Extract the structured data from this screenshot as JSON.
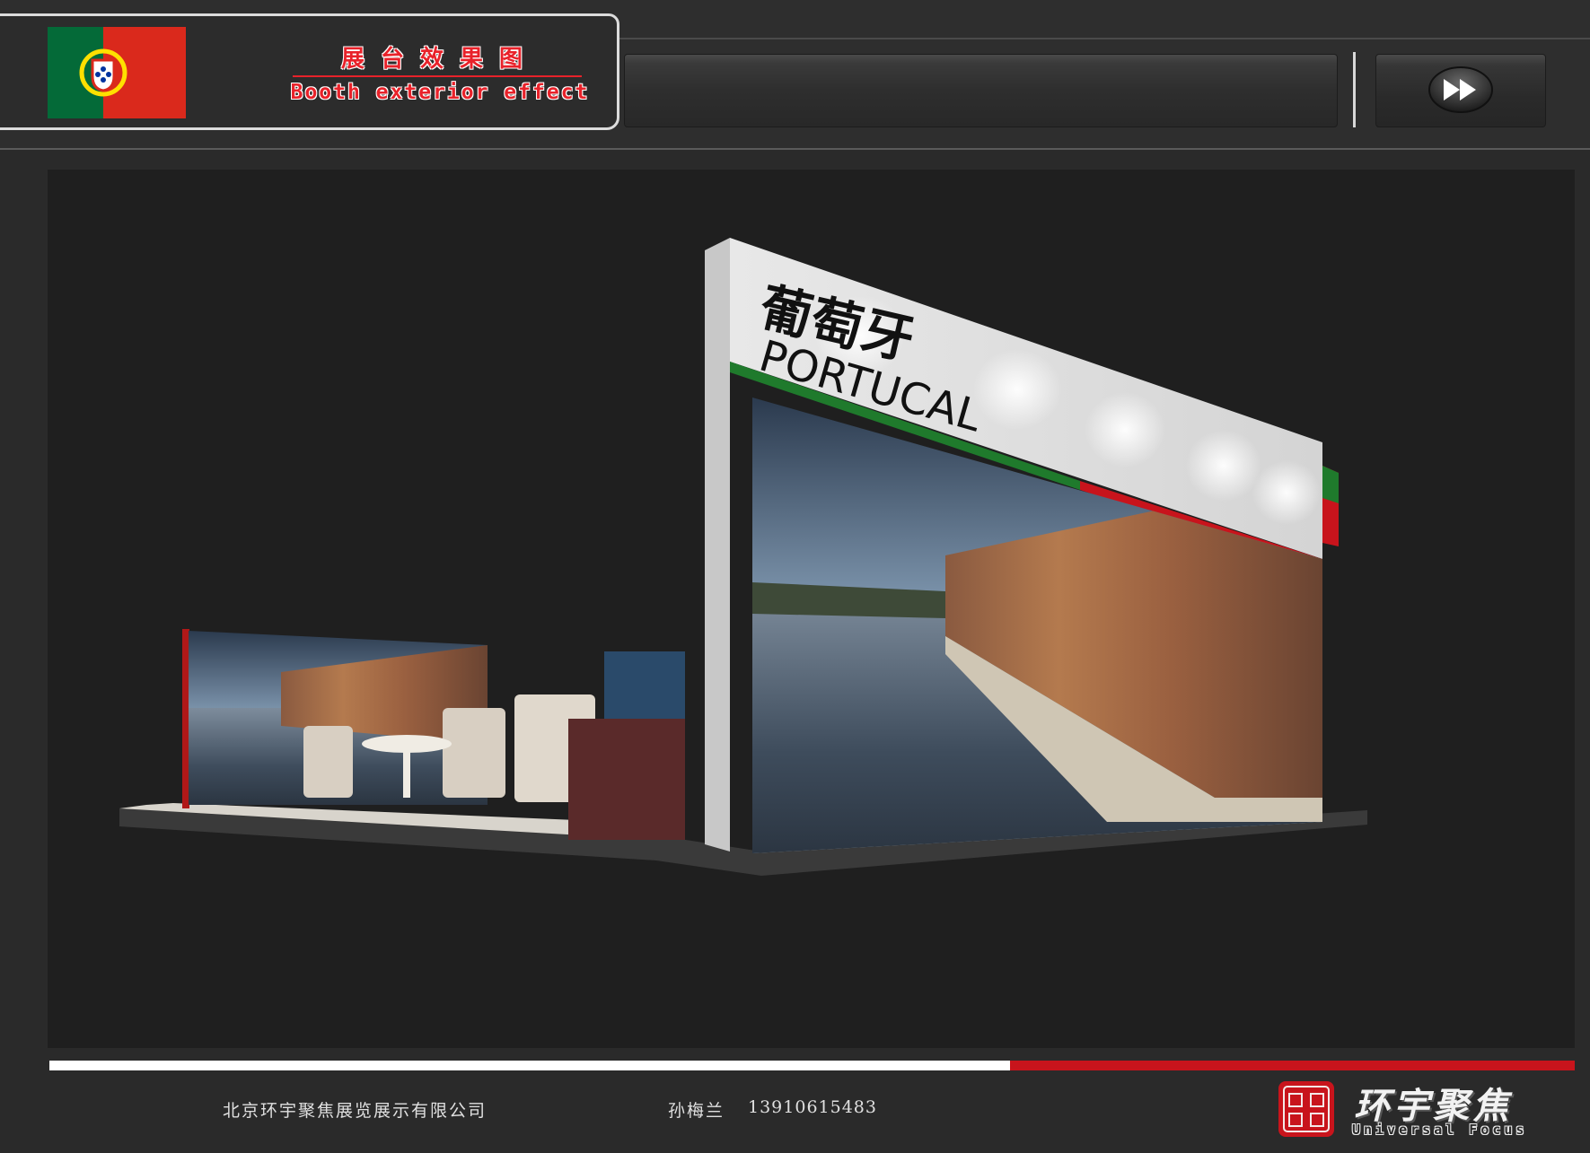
{
  "header": {
    "title_cn": "展台效果图",
    "title_en": "Booth exterior effect",
    "flag_icon": "portugal-flag-icon",
    "next_icon": "fast-forward-icon"
  },
  "render": {
    "sign_cn": "葡萄牙",
    "sign_en": "PORTUCAL"
  },
  "footer": {
    "company": "北京环宇聚焦展览展示有限公司",
    "contact_name": "孙梅兰",
    "contact_phone": "13910615483",
    "brand_cn": "环宇聚焦",
    "brand_en": "Universal Focus",
    "seal_icon": "red-seal-stamp-icon"
  },
  "colors": {
    "accent_red": "#e8222a",
    "flag_green": "#046a38",
    "flag_red": "#da291c",
    "stripe_red": "#c8141c",
    "background": "#2a2a2a"
  }
}
